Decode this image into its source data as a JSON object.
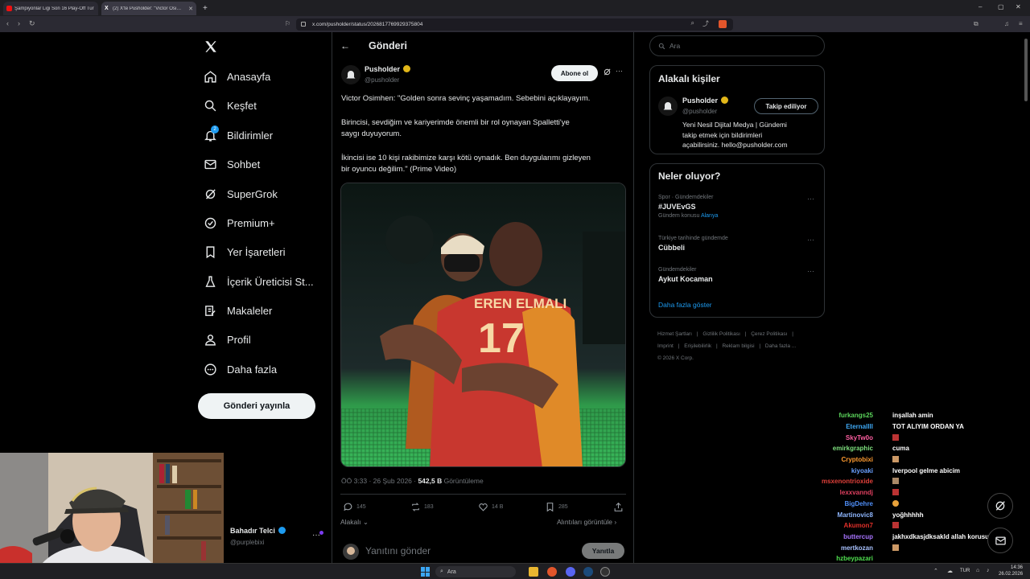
{
  "browser": {
    "tabs": [
      {
        "title": "Şampiyonlar Ligi Son 16 Play-Off Tur"
      },
      {
        "title": "(2) X'te Pusholder: \"Victor Osimhen"
      }
    ],
    "url": "x.com/pusholder/status/2026817769929375804"
  },
  "nav": {
    "items": [
      {
        "label": "Anasayfa"
      },
      {
        "label": "Keşfet"
      },
      {
        "label": "Bildirimler",
        "badge": "2"
      },
      {
        "label": "Sohbet"
      },
      {
        "label": "SuperGrok"
      },
      {
        "label": "Premium+"
      },
      {
        "label": "Yer İşaretleri"
      },
      {
        "label": "İçerik Üreticisi St..."
      },
      {
        "label": "Makaleler"
      },
      {
        "label": "Profil"
      },
      {
        "label": "Daha fazla"
      }
    ],
    "post_button": "Gönderi yayınla",
    "account": {
      "name": "Bahadır Telci",
      "handle": "@purplebixi",
      "more": "···"
    }
  },
  "post": {
    "header_title": "Gönderi",
    "author_name": "Pusholder",
    "author_handle": "@pusholder",
    "subscribe_label": "Abone ol",
    "more": "···",
    "text_lines": [
      "Victor Osimhen: \"Golden sonra sevinç yaşamadım. Sebebini açıklayayım.",
      "Birincisi, sevdiğim ve kariyerimde önemli bir rol oynayan Spalletti'ye",
      "saygı duyuyorum.",
      "İkincisi ise 10 kişi rakibimize karşı kötü oynadık. Ben duygularımı gizleyen",
      "bir oyuncu değilim.\" (Prime Video)"
    ],
    "jersey_text": "EREN ELMALI",
    "jersey_number": "17",
    "meta_time": "ÖÖ 3:33 · 26 Şub 2026 · ",
    "meta_views": "542,5 B",
    "meta_views_label": " Görüntüleme",
    "stats": {
      "replies": "145",
      "reposts": "183",
      "likes": "14 B",
      "bookmarks": "285"
    },
    "relevant_label": "Alakalı",
    "quotes_label": "Alıntıları görüntüle",
    "reply_placeholder": "Yanıtını gönder",
    "reply_button": "Yanıtla"
  },
  "sidebar": {
    "search_placeholder": "Ara",
    "relevant_people": {
      "title": "Alakalı kişiler",
      "name": "Pusholder",
      "handle": "@pusholder",
      "follow_label": "Takip ediliyor",
      "bio_lines": [
        "Yeni Nesil Dijital Medya | Gündemi",
        "takip etmek için bildirimleri",
        "açabilirsiniz. hello@pusholder.com"
      ]
    },
    "trends": {
      "title": "Neler oluyor?",
      "items": [
        {
          "category": "Spor · Gündemdekiler",
          "name": "#JUVEvGS",
          "extra_prefix": "Gündem konusu ",
          "extra_link": "Alanya"
        },
        {
          "category": "Türkiye tarihinde gündemde",
          "name": "Cübbeli",
          "extra_prefix": "",
          "extra_link": ""
        },
        {
          "category": "Gündemdekiler",
          "name": "Aykut Kocaman",
          "extra_prefix": "",
          "extra_link": ""
        }
      ],
      "show_more": "Daha fazla göster"
    },
    "footer": {
      "line1": [
        "Hizmet Şartları",
        "Gizlilik Politikası",
        "Çerez Politikası"
      ],
      "line2": [
        "Imprint",
        "Erişilebilirlik",
        "Reklam bilgisi",
        "Daha fazla ..."
      ],
      "copyright": "© 2026 X Corp."
    }
  },
  "chat": [
    {
      "user": "furkangs25",
      "msg": "inşallah amin",
      "color": "#5bd45b"
    },
    {
      "user": "Eternallll",
      "msg": "TOT ALIYIM ORDAN YA",
      "color": "#3fa9f5"
    },
    {
      "user": "SkyTw0o",
      "msg": "",
      "color": "#ff5fa2"
    },
    {
      "user": "emirkgraphic",
      "msg": "cuma",
      "color": "#7ee07e"
    },
    {
      "user": "Cryptobixi",
      "msg": "",
      "color": "#ff9b30"
    },
    {
      "user": "kiyoaki",
      "msg": "lverpool gelme abicim",
      "color": "#6aa0ff"
    },
    {
      "user": "msxenontrioxide",
      "msg": "",
      "color": "#e0403a"
    },
    {
      "user": "lexxvanndj",
      "msg": "",
      "color": "#e04060"
    },
    {
      "user": "BigDehre",
      "msg": "",
      "color": "#4f8ef7"
    },
    {
      "user": "Martinovic8",
      "msg": "yoğhhhhh",
      "color": "#8fb7ff"
    },
    {
      "user": "Akumon7",
      "msg": "",
      "color": "#e0302a"
    },
    {
      "user": "buttercup",
      "msg": "jakhxdkasjdksakld allah korusun",
      "color": "#a874ff"
    },
    {
      "user": "mertkozan",
      "msg": "",
      "color": "#a9c2ff"
    },
    {
      "user": "hzbeypazari",
      "msg": "",
      "color": "#50e050"
    }
  ],
  "taskbar": {
    "search": "Ara",
    "lang": "TUR",
    "time": "14:36",
    "date": "26.02.2026"
  },
  "colors": {
    "accent": "#1d9bf0",
    "verified": "#e2b719",
    "x_bg": "#000000",
    "border": "#2f3336"
  }
}
